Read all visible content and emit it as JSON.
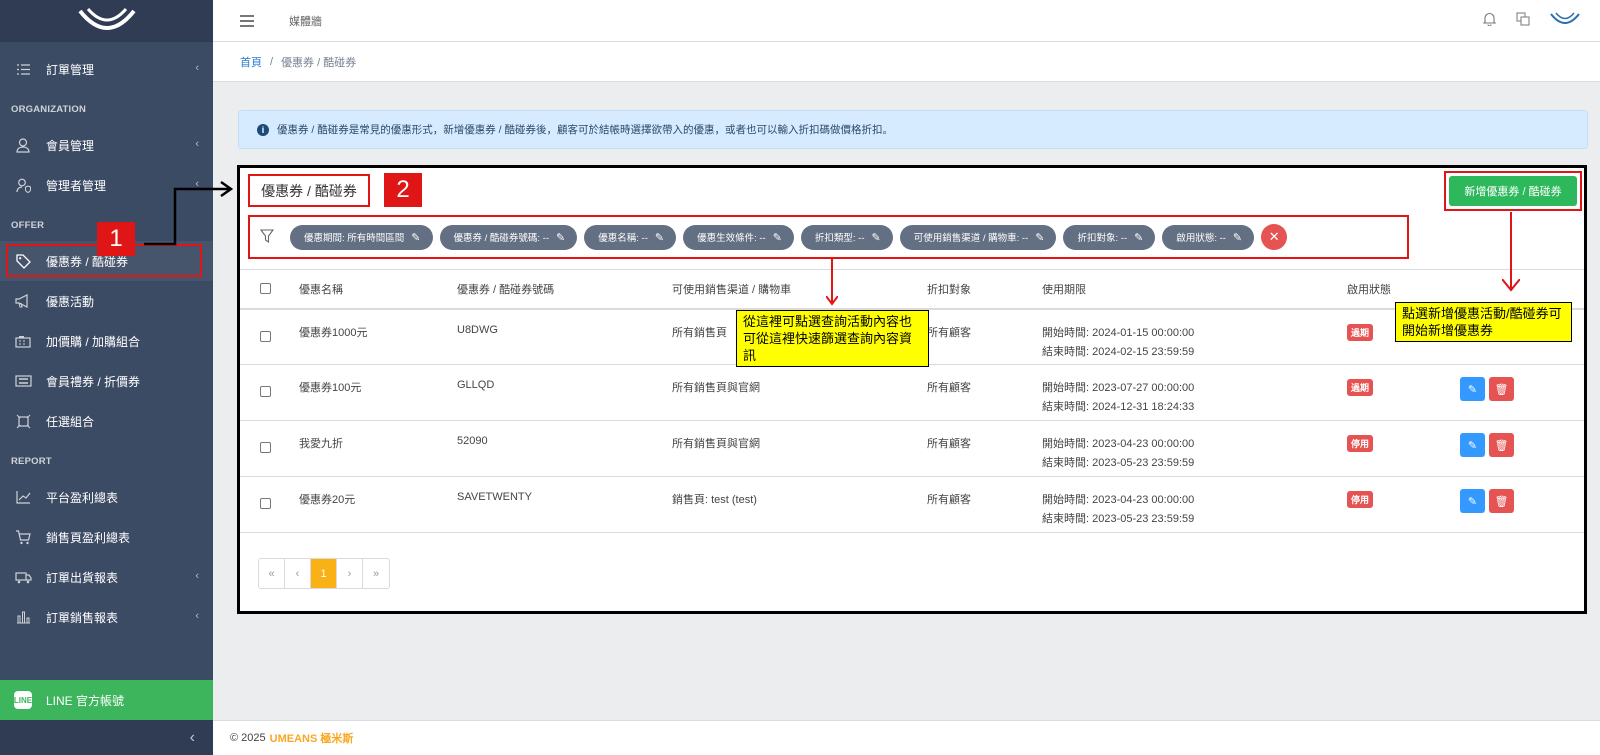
{
  "sidebar": {
    "logo": "logo-icon",
    "order_mgmt": "訂單管理",
    "section_org": "ORGANIZATION",
    "member_mgmt": "會員管理",
    "admin_mgmt": "管理者管理",
    "section_offer": "OFFER",
    "coupon": "優惠券 / 酷碰券",
    "promotion": "優惠活動",
    "addon": "加價購 / 加購組合",
    "gift_voucher": "會員禮券 / 折價券",
    "bundle": "任選組合",
    "section_report": "REPORT",
    "platform_profit": "平台盈利總表",
    "sales_page_profit": "銷售頁盈利總表",
    "shipping_report": "訂單出貨報表",
    "order_sales_report": "訂單銷售報表",
    "line_account": "LINE 官方帳號",
    "line_badge": "LINE"
  },
  "header": {
    "nav_link": "媒體牆"
  },
  "breadcrumb": {
    "home": "首頁",
    "separator": "/",
    "current": "優惠券 / 酷碰券"
  },
  "alert": {
    "text": "優惠券 / 酷碰券是常見的優惠形式，新增優惠券 / 酷碰券後，顧客可於結帳時選擇欲帶入的優惠，或者也可以輸入折扣碼做價格折扣。"
  },
  "card": {
    "title": "優惠券 / 酷碰券",
    "add_button": "新增優惠券 / 酷碰券"
  },
  "filters": [
    "優惠期間: 所有時間區間",
    "優惠券 / 酷碰券號碼: --",
    "優惠名稱: --",
    "優惠生效條件: --",
    "折扣類型: --",
    "可使用銷售渠道 / 購物車: --",
    "折扣對象: --",
    "啟用狀態: --"
  ],
  "table": {
    "headers": [
      "優惠名稱",
      "優惠券 / 酷碰券號碼",
      "可使用銷售渠道 / 購物車",
      "折扣對象",
      "使用期限",
      "啟用狀態"
    ],
    "rows": [
      {
        "name": "優惠券1000元",
        "code": "U8DWG",
        "channel": "所有銷售頁",
        "target": "所有顧客",
        "start": "開始時間: 2024-01-15 00:00:00",
        "end": "結束時間: 2024-02-15 23:59:59",
        "status": "過期"
      },
      {
        "name": "優惠券100元",
        "code": "GLLQD",
        "channel": "所有銷售頁與官網",
        "target": "所有顧客",
        "start": "開始時間: 2023-07-27 00:00:00",
        "end": "結束時間: 2024-12-31 18:24:33",
        "status": "過期"
      },
      {
        "name": "我愛九折",
        "code": "52090",
        "channel": "所有銷售頁與官網",
        "target": "所有顧客",
        "start": "開始時間: 2023-04-23 00:00:00",
        "end": "結束時間: 2023-05-23 23:59:59",
        "status": "停用"
      },
      {
        "name": "優惠券20元",
        "code": "SAVETWENTY",
        "channel": "銷售頁: test (test)",
        "target": "所有顧客",
        "start": "開始時間: 2023-04-23 00:00:00",
        "end": "結束時間: 2023-05-23 23:59:59",
        "status": "停用"
      }
    ]
  },
  "pagination": [
    "«",
    "‹",
    "1",
    "›",
    "»"
  ],
  "annotations": {
    "num1": "1",
    "num2": "2",
    "filter_note": "從這裡可點選查詢活動內容也可從這裡快速篩選查詢內容資訊",
    "add_note": "點選新增優惠活動/酷碰券可開始新增優惠券"
  },
  "footer": {
    "copyright": "© 2025",
    "brand": "UMEANS 極米斯"
  },
  "colors": {
    "sidebar": "#3c4b64",
    "accent_green": "#2eb85c",
    "danger": "#e55353",
    "primary": "#3399ff",
    "annotation_red": "#e01515",
    "annotation_yellow": "#ffff00"
  }
}
